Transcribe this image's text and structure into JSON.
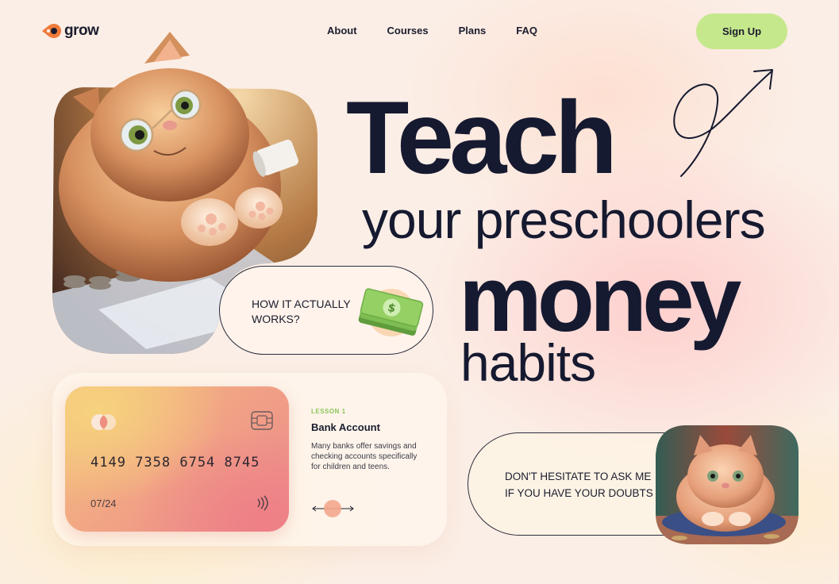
{
  "header": {
    "logo_text": "grow",
    "nav": [
      "About",
      "Courses",
      "Plans",
      "FAQ"
    ],
    "signup_label": "Sign Up"
  },
  "hero": {
    "line1": "Teach",
    "line2": "your preschoolers",
    "line3": "money",
    "line4": "habits",
    "how_it_works": "HOW IT ACTUALLY WORKS?"
  },
  "lesson": {
    "card_number": "4149 7358 6754 8745",
    "card_expiry": "07/24",
    "label": "LESSON 1",
    "title": "Bank Account",
    "description": "Many banks offer savings and checking accounts specifically for children and teens."
  },
  "ask": {
    "text": "DON'T HESITATE TO ASK ME IF YOU HAVE YOUR DOUBTS"
  },
  "colors": {
    "accent_green": "#c6e88c",
    "ink": "#161a30",
    "lesson_label": "#8cc65c",
    "logo_orange": "#f07a3a"
  },
  "icons": [
    "logo-mark-icon",
    "arrow-squiggle-icon",
    "money-stack-icon",
    "card-brand-icon",
    "card-chip-icon",
    "contactless-icon",
    "slider-arrows-icon"
  ]
}
